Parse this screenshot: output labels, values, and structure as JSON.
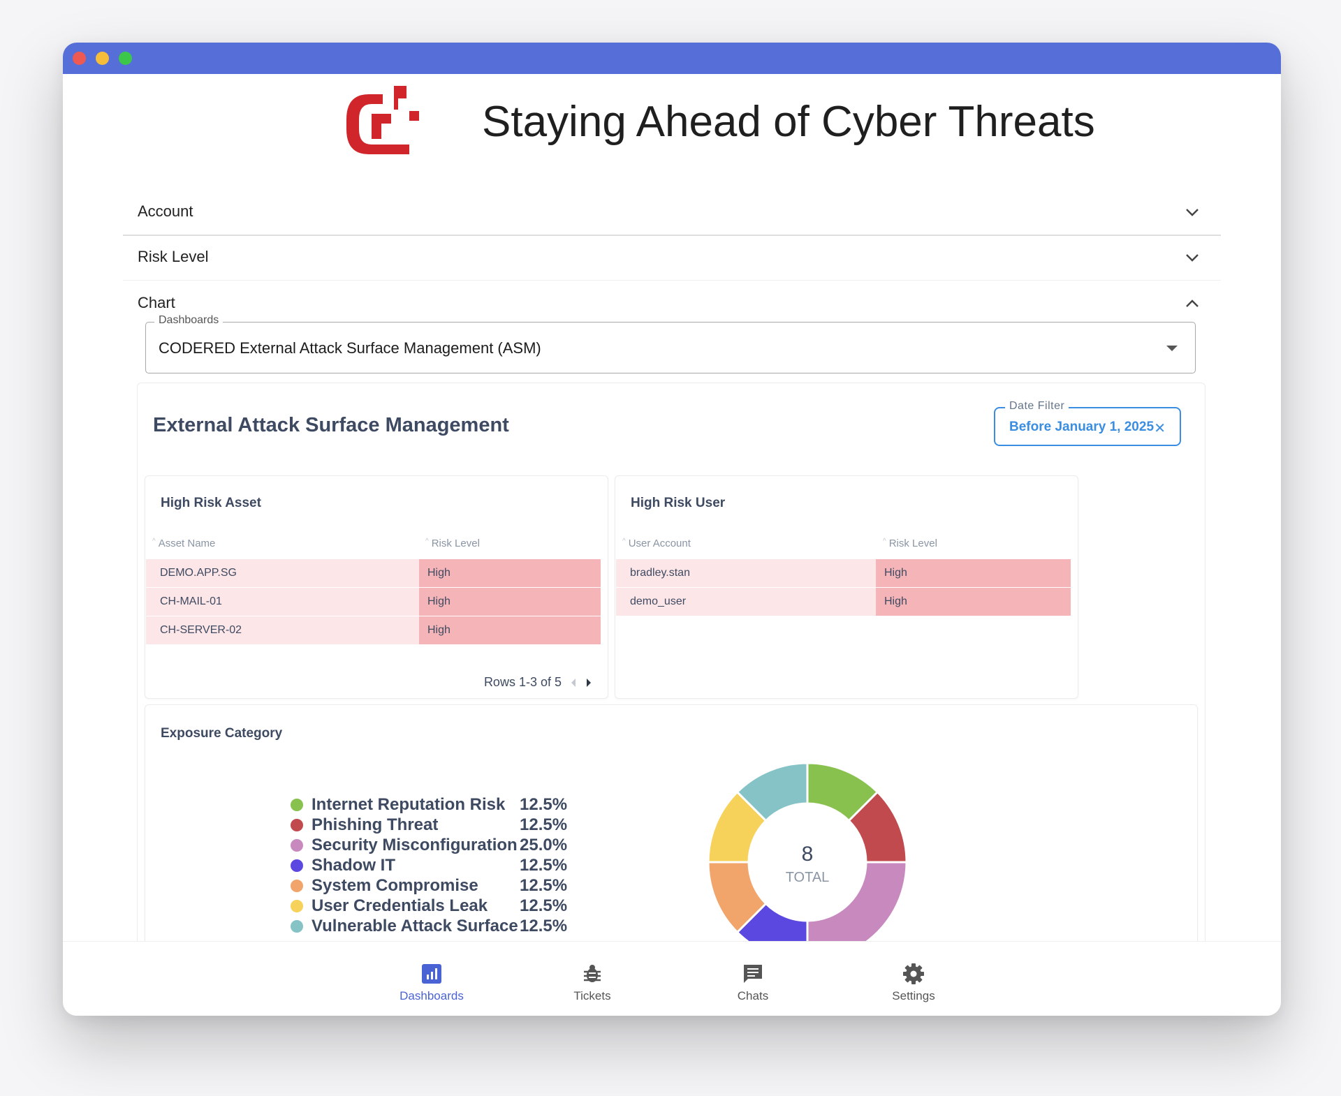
{
  "app": {
    "title": "Staying Ahead of Cyber Threats"
  },
  "colors": {
    "titlebar": "#566ed8",
    "brand_red": "#d1252c",
    "accent_blue": "#3a8de0",
    "nav_active": "#4a63d4"
  },
  "accordion": [
    {
      "label": "Account",
      "expanded": false
    },
    {
      "label": "Risk Level",
      "expanded": false
    },
    {
      "label": "Chart",
      "expanded": true
    }
  ],
  "dashboard_select": {
    "label": "Dashboards",
    "value": "CODERED External Attack Surface Management (ASM)"
  },
  "dashboard": {
    "title": "External Attack Surface Management",
    "date_filter": {
      "label": "Date Filter",
      "value": "Before January 1, 2025",
      "clear_icon": "close-icon"
    },
    "high_risk_asset": {
      "title": "High Risk Asset",
      "columns": [
        "Asset Name",
        "Risk Level"
      ],
      "rows": [
        [
          "DEMO.APP.SG",
          "High"
        ],
        [
          "CH-MAIL-01",
          "High"
        ],
        [
          "CH-SERVER-02",
          "High"
        ]
      ],
      "pagination": "Rows 1-3 of 5"
    },
    "high_risk_user": {
      "title": "High Risk User",
      "columns": [
        "User Account",
        "Risk Level"
      ],
      "rows": [
        [
          "bradley.stan",
          "High"
        ],
        [
          "demo_user",
          "High"
        ]
      ]
    },
    "exposure": {
      "title": "Exposure Category",
      "total_value": "8",
      "total_label": "TOTAL"
    }
  },
  "chart_data": {
    "type": "pie",
    "title": "Exposure Category",
    "categories": [
      "Internet Reputation Risk",
      "Phishing Threat",
      "Security Misconfiguration",
      "Shadow IT",
      "System Compromise",
      "User Credentials Leak",
      "Vulnerable Attack Surface"
    ],
    "values": [
      12.5,
      12.5,
      25.0,
      12.5,
      12.5,
      12.5,
      12.5
    ],
    "labels": [
      "12.5%",
      "12.5%",
      "25.0%",
      "12.5%",
      "12.5%",
      "12.5%",
      "12.5%"
    ],
    "colors": [
      "#88c14e",
      "#c04a4e",
      "#c889bf",
      "#5b48e0",
      "#f1a56b",
      "#f6d25a",
      "#86c3c6"
    ],
    "legend_placement": "left",
    "donut": true
  },
  "nav": [
    {
      "label": "Dashboards",
      "icon": "bar-chart-icon",
      "active": true
    },
    {
      "label": "Tickets",
      "icon": "bug-icon",
      "active": false
    },
    {
      "label": "Chats",
      "icon": "chat-icon",
      "active": false
    },
    {
      "label": "Settings",
      "icon": "gear-icon",
      "active": false
    }
  ]
}
